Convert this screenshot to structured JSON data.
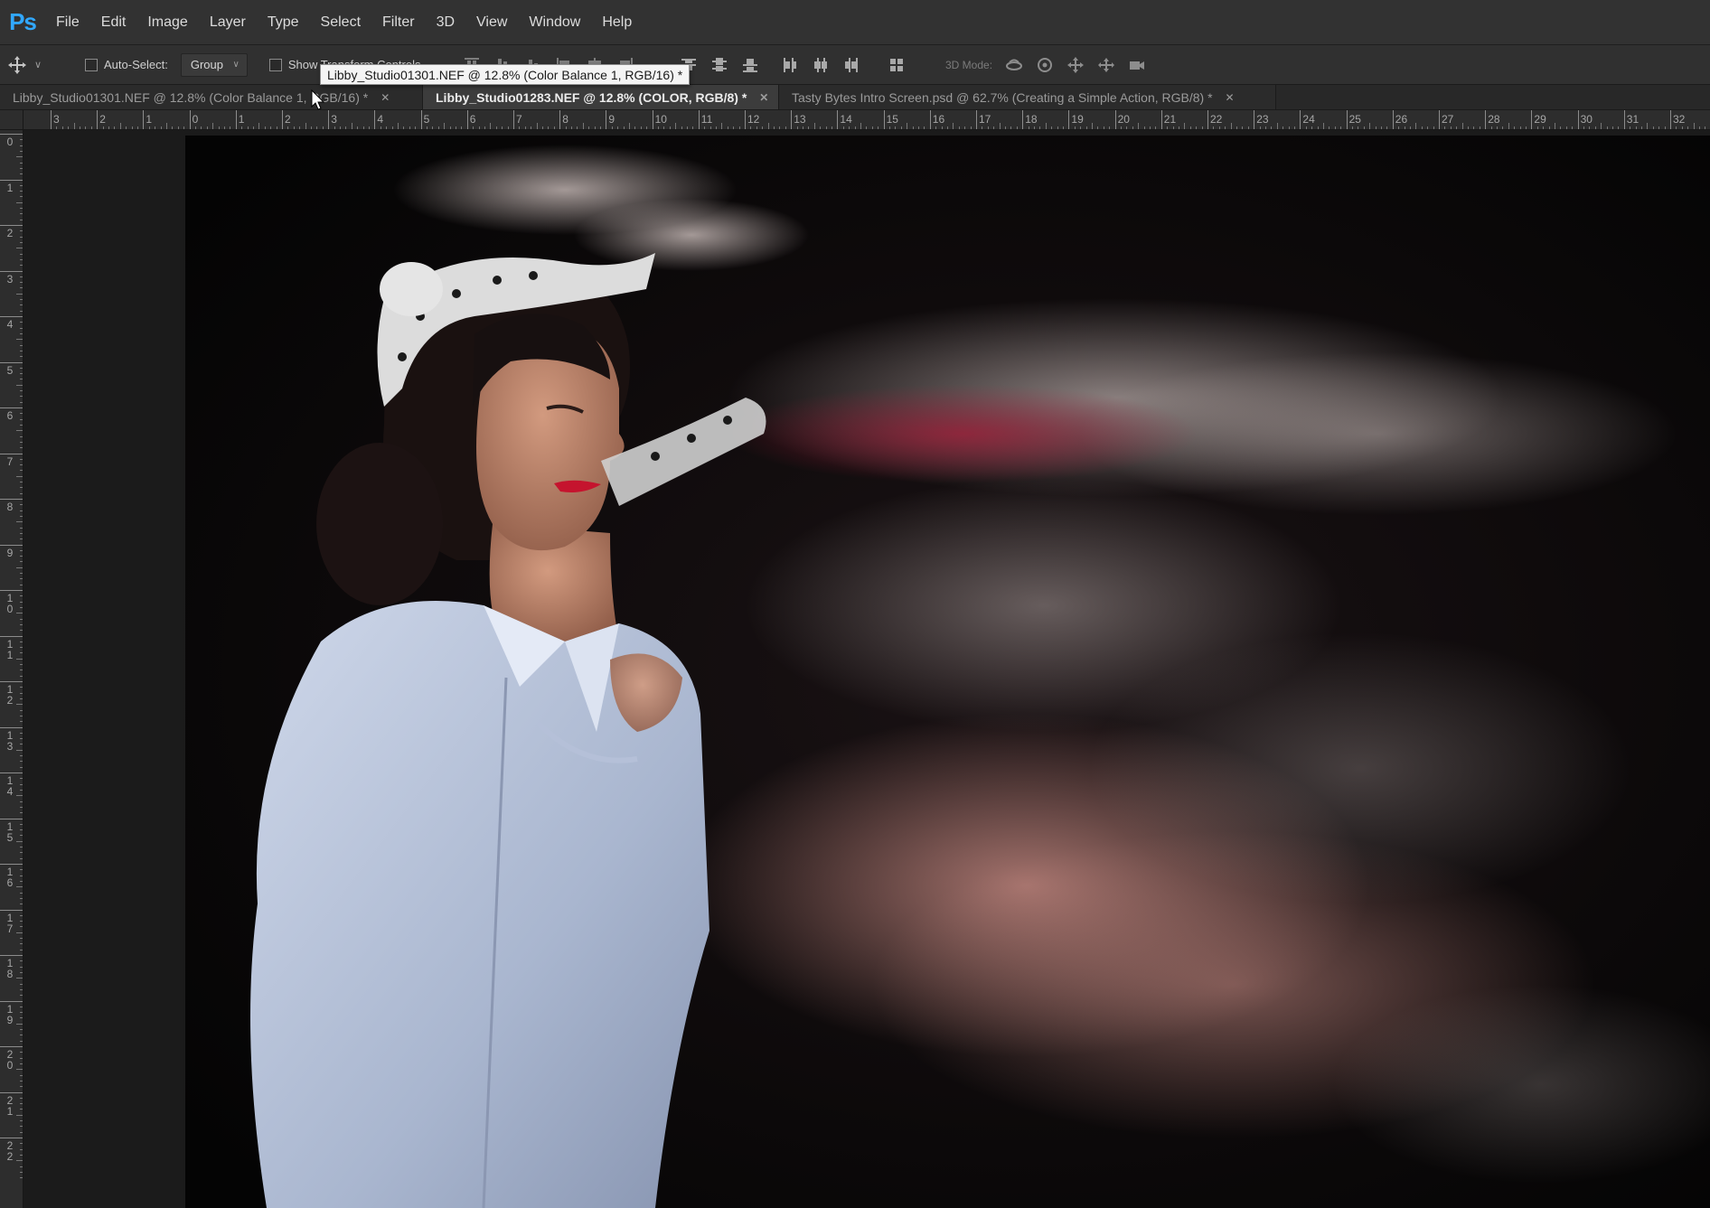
{
  "app": {
    "logo": "Ps"
  },
  "menu": [
    "File",
    "Edit",
    "Image",
    "Layer",
    "Type",
    "Select",
    "Filter",
    "3D",
    "View",
    "Window",
    "Help"
  ],
  "options": {
    "move_tool_icon": "move-icon",
    "auto_select_label": "Auto-Select:",
    "auto_select_value": "Group",
    "show_transform_label": "Show Transform Controls",
    "mode_3d_label": "3D Mode:"
  },
  "tooltip": "Libby_Studio01301.NEF @ 12.8% (Color Balance 1, RGB/16) *",
  "tabs": [
    {
      "label": "Libby_Studio01301.NEF @ 12.8% (Color Balance 1, RGB/16) *",
      "active": false
    },
    {
      "label": "Libby_Studio01283.NEF @ 12.8% (COLOR, RGB/8) *",
      "active": true
    },
    {
      "label": "Tasty Bytes Intro Screen.psd @ 62.7% (Creating a Simple Action, RGB/8) *",
      "active": false
    }
  ],
  "ruler_h": [
    "3",
    "2",
    "1",
    "0",
    "1",
    "2",
    "3",
    "4",
    "5",
    "6",
    "7",
    "8",
    "9",
    "10",
    "11",
    "12",
    "13",
    "14",
    "15",
    "16",
    "17",
    "18",
    "19",
    "20",
    "21",
    "22",
    "23",
    "24",
    "25",
    "26",
    "27",
    "28",
    "29",
    "30",
    "31",
    "32"
  ],
  "ruler_v": [
    "0",
    "1",
    "2",
    "3",
    "4",
    "5",
    "6",
    "7",
    "8",
    "9",
    "10",
    "11",
    "12",
    "13",
    "14",
    "15",
    "16",
    "17",
    "18",
    "19",
    "20",
    "21",
    "22"
  ],
  "colors": {
    "accent": "#31a8ff",
    "lips": "#c5142e"
  }
}
